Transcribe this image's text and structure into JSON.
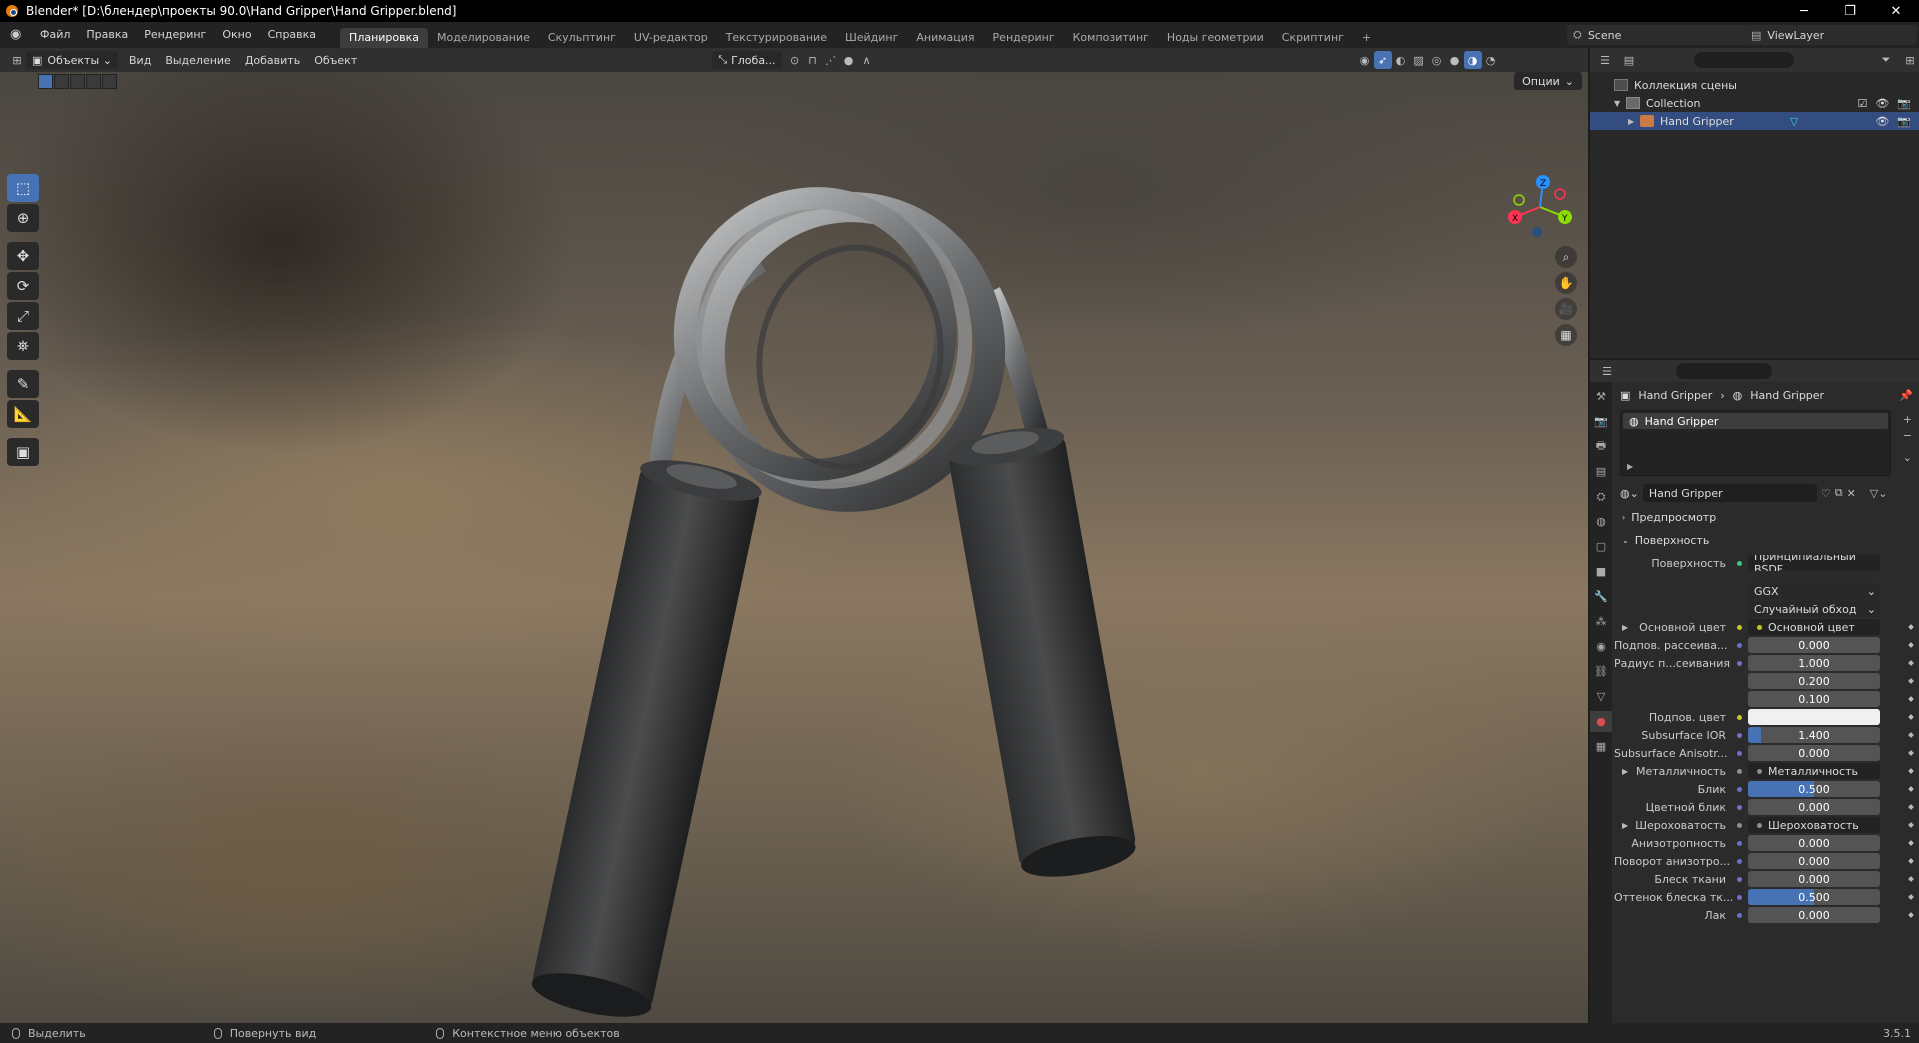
{
  "titlebar": {
    "title": "Blender* [D:\\блендер\\проекты 90.0\\Hand Gripper\\Hand Gripper.blend]",
    "minimize": "─",
    "maximize": "❐",
    "close": "✕"
  },
  "menus": [
    "Файл",
    "Правка",
    "Рендеринг",
    "Окно",
    "Справка"
  ],
  "workspaces": [
    {
      "label": "Планировка",
      "active": true
    },
    {
      "label": "Моделирование"
    },
    {
      "label": "Скульптинг"
    },
    {
      "label": "UV-редактор"
    },
    {
      "label": "Текстурирование"
    },
    {
      "label": "Шейдинг"
    },
    {
      "label": "Анимация"
    },
    {
      "label": "Рендеринг"
    },
    {
      "label": "Композитинг"
    },
    {
      "label": "Ноды геометрии"
    },
    {
      "label": "Скриптинг"
    }
  ],
  "add_workspace": "+",
  "scene": {
    "name": "Scene"
  },
  "viewlayer": {
    "name": "ViewLayer"
  },
  "viewport_header": {
    "mode": "Объекты",
    "menus": [
      "Вид",
      "Выделение",
      "Добавить",
      "Объект"
    ],
    "transform_orientation": "Глоба...",
    "options": "Опции"
  },
  "outliner": {
    "root": "Коллекция сцены",
    "collection": "Collection",
    "object": "Hand Gripper"
  },
  "properties": {
    "breadcrumb_object": "Hand Gripper",
    "breadcrumb_material": "Hand Gripper",
    "slot_name": "Hand Gripper",
    "material_name": "Hand Gripper",
    "panel_preview": "Предпросмотр",
    "panel_surface": "Поверхность",
    "surface_label": "Поверхность",
    "surface_value": "Принципиальный BSDF",
    "distribution": "GGX",
    "subsurface_method": "Случайный обход",
    "rows": [
      {
        "label": "Основной цвет",
        "value": "Основной цвет",
        "type": "link",
        "dot": "yellow",
        "expand": true
      },
      {
        "label": "Подпов. рассеива...",
        "value": "0.000",
        "type": "num",
        "fill": 0
      },
      {
        "label": "Радиус п...сеивания",
        "value": "1.000",
        "type": "num",
        "fill": 0
      },
      {
        "label": "",
        "value": "0.200",
        "type": "num",
        "fill": 0
      },
      {
        "label": "",
        "value": "0.100",
        "type": "num",
        "fill": 0
      },
      {
        "label": "Подпов. цвет",
        "value": "",
        "type": "color",
        "dot": "yellow"
      },
      {
        "label": "Subsurface IOR",
        "value": "1.400",
        "type": "num",
        "fill": 0.1
      },
      {
        "label": "Subsurface Anisotr...",
        "value": "0.000",
        "type": "num",
        "fill": 0
      },
      {
        "label": "Металличность",
        "value": "Металличность",
        "type": "link",
        "dot": "grey",
        "expand": true
      },
      {
        "label": "Блик",
        "value": "0.500",
        "type": "num",
        "fill": 0.5
      },
      {
        "label": "Цветной блик",
        "value": "0.000",
        "type": "num",
        "fill": 0
      },
      {
        "label": "Шероховатость",
        "value": "Шероховатость",
        "type": "link",
        "dot": "grey",
        "expand": true
      },
      {
        "label": "Анизотропность",
        "value": "0.000",
        "type": "num",
        "fill": 0
      },
      {
        "label": "Поворот анизотро...",
        "value": "0.000",
        "type": "num",
        "fill": 0
      },
      {
        "label": "Блеск ткани",
        "value": "0.000",
        "type": "num",
        "fill": 0
      },
      {
        "label": "Оттенок блеска тк...",
        "value": "0.500",
        "type": "num",
        "fill": 0.5
      },
      {
        "label": "Лак",
        "value": "0.000",
        "type": "num",
        "fill": 0
      }
    ]
  },
  "statusbar": {
    "select": "Выделить",
    "rotate": "Повернуть вид",
    "context": "Контекстное меню объектов",
    "version": "3.5.1"
  },
  "gizmo": {
    "x": "X",
    "y": "Y",
    "z": "Z"
  },
  "colors": {
    "accent": "#4772b3",
    "selected_row": "#334d80"
  }
}
